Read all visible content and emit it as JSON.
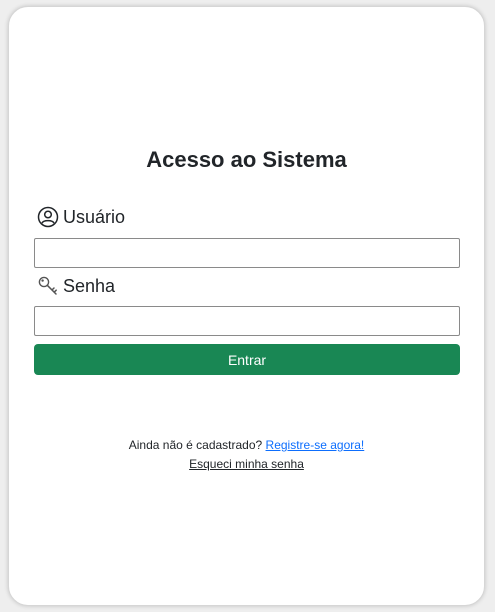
{
  "page": {
    "title": "Acesso ao Sistema"
  },
  "form": {
    "username": {
      "label": "Usuário",
      "icon": "user-circle-icon",
      "value": "",
      "placeholder": ""
    },
    "password": {
      "label": "Senha",
      "icon": "key-icon",
      "value": "",
      "placeholder": ""
    },
    "submit_label": "Entrar"
  },
  "footer": {
    "register_prompt": "Ainda não é cadastrado?",
    "register_link": "Registre-se agora!",
    "forgot_link": "Esqueci minha senha"
  },
  "colors": {
    "primary_button": "#198754",
    "link": "#0d6efd",
    "text": "#212529"
  }
}
